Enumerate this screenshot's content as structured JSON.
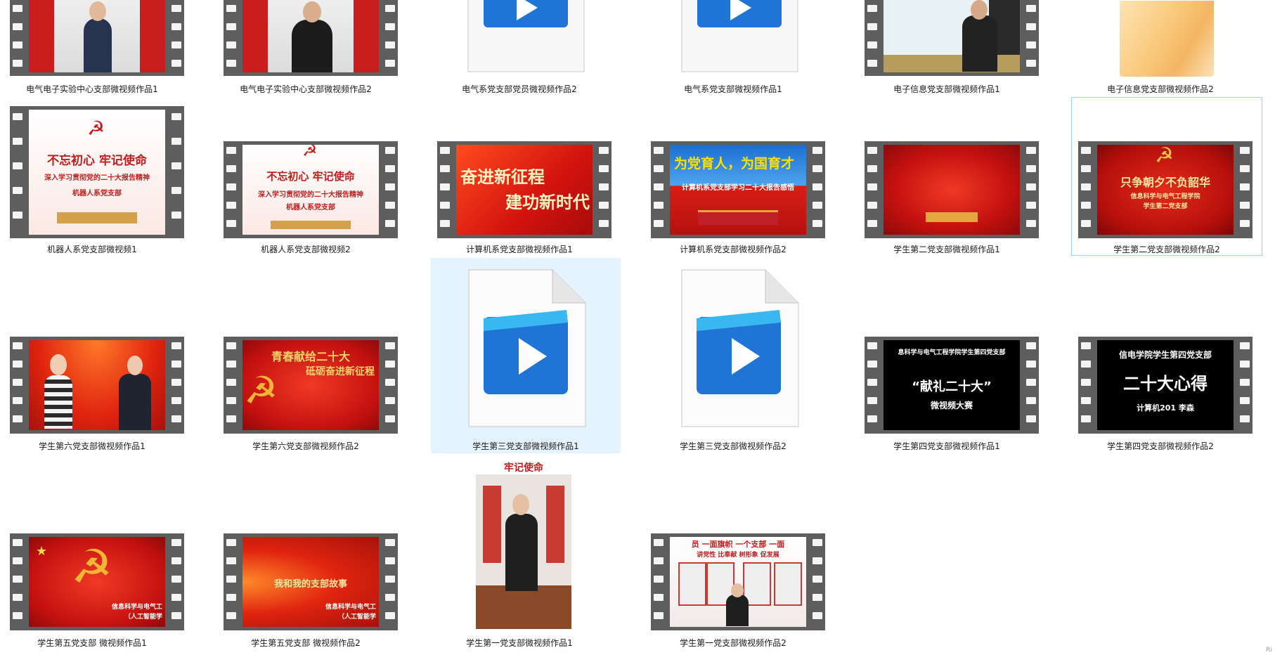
{
  "colors": {
    "selection_bg": "#e5f3ff",
    "focus_border": "#99d1ff",
    "film_strip": "#5e5e5e",
    "party_red": "#d91f16",
    "gold": "#f6c343",
    "file_blue": "#1a73d1"
  },
  "files": [
    {
      "label": "电气电子实验中心支部微视频作品1",
      "icon": "film-video-thumbnail",
      "frame_text": ""
    },
    {
      "label": "电气电子实验中心支部微视频作品2",
      "icon": "film-video-thumbnail",
      "frame_text": ""
    },
    {
      "label": "电气系党支部党员微视频作品2",
      "icon": "video-file-icon",
      "frame_text": ""
    },
    {
      "label": "电气系党支部微视频作品1",
      "icon": "video-file-icon",
      "frame_text": ""
    },
    {
      "label": "电子信息党支部微视频作品1",
      "icon": "film-video-thumbnail",
      "frame_text": ""
    },
    {
      "label": "电子信息党支部微视频作品2",
      "icon": "image-thumbnail",
      "frame_text": ""
    },
    {
      "label": "机器人系党支部微视频1",
      "icon": "film-video-thumbnail",
      "frame_text": "不忘初心 牢记使命",
      "frame_sub": "深入学习贯彻党的二十大报告精神",
      "frame_sub2": "机器人系党支部"
    },
    {
      "label": "机器人系党支部微视频2",
      "icon": "film-video-thumbnail",
      "frame_text": "不忘初心 牢记使命",
      "frame_sub": "深入学习贯彻党的二十大报告精神",
      "frame_sub2": "机器人系党支部"
    },
    {
      "label": "计算机系党支部微视频作品1",
      "icon": "film-video-thumbnail",
      "frame_text": "奋进新征程",
      "frame_sub": "建功新时代"
    },
    {
      "label": "计算机系党支部微视频作品2",
      "icon": "film-video-thumbnail",
      "frame_text": "为党育人，为国育才",
      "frame_sub": "计算机系党支部学习二十大报告感悟"
    },
    {
      "label": "学生第二党支部微视频作品1",
      "icon": "film-video-thumbnail",
      "frame_text": ""
    },
    {
      "label": "学生第二党支部微视频作品2",
      "icon": "film-video-thumbnail",
      "frame_text": "只争朝夕不负韶华",
      "frame_sub": "信息科学与电气工程学院",
      "frame_sub2": "学生第二党支部"
    },
    {
      "label": "学生第六党支部微视频作品1",
      "icon": "film-video-thumbnail",
      "frame_text": ""
    },
    {
      "label": "学生第六党支部微视频作品2",
      "icon": "film-video-thumbnail",
      "frame_text": "青春献给二十大",
      "frame_sub": "砥砺奋进新征程"
    },
    {
      "label": "学生第三党支部微视频作品1",
      "icon": "video-file-icon",
      "frame_text": ""
    },
    {
      "label": "学生第三党支部微视频作品2",
      "icon": "video-file-icon",
      "frame_text": ""
    },
    {
      "label": "学生第四党支部微视频作品1",
      "icon": "film-video-thumbnail",
      "frame_text": "“献礼二十大”",
      "frame_sub": "息科学与电气工程学院学生第四党支部",
      "frame_sub2": "微视频大赛"
    },
    {
      "label": "学生第四党支部微视频作品2",
      "icon": "film-video-thumbnail",
      "frame_text": "二十大心得",
      "frame_sub": "信电学院学生第四党支部",
      "frame_sub2": "计算机201 李森"
    },
    {
      "label": "学生第五党支部 微视频作品1",
      "icon": "film-video-thumbnail",
      "frame_text": "",
      "frame_sub": "信息科学与电气工",
      "frame_sub2": "（人工智能学"
    },
    {
      "label": "学生第五党支部 微视频作品2",
      "icon": "film-video-thumbnail",
      "frame_text": "我和我的支部故事",
      "frame_sub": "信息科学与电气工",
      "frame_sub2": "（人工智能学"
    },
    {
      "label": "学生第一党支部微视频作品1",
      "icon": "portrait-photo-thumbnail",
      "frame_text": "牢记使命"
    },
    {
      "label": "学生第一党支部微视频作品2",
      "icon": "film-video-thumbnail",
      "frame_text": "员 一面旗帜 一个支部 一面",
      "frame_sub": "讲党性 比奉献 树形象 促发展"
    }
  ],
  "corner_text": "Ri"
}
